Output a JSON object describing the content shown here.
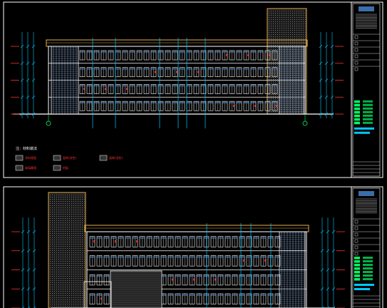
{
  "drawing": {
    "background": "#000000",
    "frame_color": "#ffffff",
    "facade_color": "#ffffff",
    "roof_color": "#e8b050",
    "stair_tower_color": "#e8b050",
    "dim_color": "#00c8ff",
    "level_color": "#ff3030",
    "axis_color": "#00ff66",
    "sheet_top": {
      "legend_title": "注：材料做法",
      "legend_items": [
        "涂料墙面",
        "面砖(深色)",
        "面砖(浅色)",
        "玻璃幕墙",
        "铝板"
      ],
      "floors": 4
    },
    "sheet_bottom": {
      "floors": 4
    }
  }
}
